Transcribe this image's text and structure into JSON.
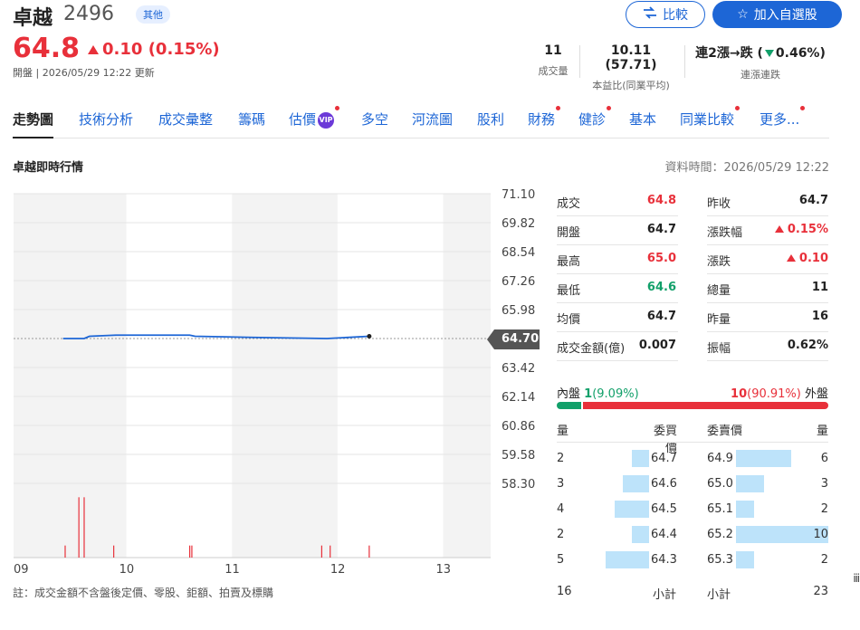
{
  "header": {
    "name": "卓越",
    "code": "2496",
    "badge": "其他",
    "compare_label": "比較",
    "watch_label": "加入自選股",
    "price": "64.8",
    "change": "0.10",
    "change_pct": "(0.15%)",
    "sub_info": "開盤 | 2026/05/29 12:22 更新"
  },
  "stats": {
    "volume_value": "11",
    "volume_label": "成交量",
    "pe_value": "10.11 (57.71)",
    "pe_label": "本益比(同業平均)",
    "streak_prefix": "連2漲→跌 (",
    "streak_pct": "0.46%)",
    "streak_label": "連漲連跌"
  },
  "tabs": [
    {
      "label": "走勢圖",
      "active": true
    },
    {
      "label": "技術分析"
    },
    {
      "label": "成交彙整"
    },
    {
      "label": "籌碼"
    },
    {
      "label": "估價",
      "vip": "VIP",
      "dot": true
    },
    {
      "label": "多空"
    },
    {
      "label": "河流圖"
    },
    {
      "label": "股利"
    },
    {
      "label": "財務",
      "dot": true
    },
    {
      "label": "健診",
      "dot": true
    },
    {
      "label": "基本"
    },
    {
      "label": "同業比較",
      "dot": true
    },
    {
      "label": "更多...",
      "dot": true
    }
  ],
  "section": {
    "title": "卓越即時行情",
    "data_time": "資料時間：2026/05/29 12:22"
  },
  "chart_data": {
    "type": "line",
    "y_ticks": [
      "71.10",
      "69.82",
      "68.54",
      "67.26",
      "65.98",
      "64.70",
      "63.42",
      "62.14",
      "60.86",
      "59.58",
      "58.30"
    ],
    "x_ticks": [
      "09",
      "10",
      "11",
      "12",
      "13"
    ],
    "reference_price": 64.7,
    "ylim": [
      58.3,
      71.1
    ],
    "series": [
      {
        "x": [
          9.4,
          9.6,
          9.65,
          9.9,
          10.2,
          10.6,
          10.65,
          11.2,
          11.9,
          12.3
        ],
        "y": [
          64.7,
          64.7,
          64.8,
          64.85,
          64.85,
          64.85,
          64.8,
          64.75,
          64.7,
          64.8
        ]
      }
    ],
    "volume": {
      "x": [
        9.42,
        9.55,
        9.6,
        9.88,
        10.6,
        10.62,
        11.85,
        11.93,
        12.3
      ],
      "v": [
        1,
        5,
        5,
        1,
        1,
        1,
        1,
        1,
        1
      ]
    },
    "current_label": "64.70"
  },
  "quote": {
    "rows": [
      {
        "l1": "成交",
        "v1": "64.8",
        "c1": "red",
        "l2": "昨收",
        "v2": "64.7",
        "c2": ""
      },
      {
        "l1": "開盤",
        "v1": "64.7",
        "c1": "",
        "l2": "漲跌幅",
        "v2": "0.15%",
        "c2": "red"
      },
      {
        "l1": "最高",
        "v1": "65.0",
        "c1": "red",
        "l2": "漲跌",
        "v2": "0.10",
        "c2": "red"
      },
      {
        "l1": "最低",
        "v1": "64.6",
        "c1": "green",
        "l2": "總量",
        "v2": "11",
        "c2": ""
      },
      {
        "l1": "均價",
        "v1": "64.7",
        "c1": "",
        "l2": "昨量",
        "v2": "16",
        "c2": ""
      },
      {
        "l1": "成交金額(億)",
        "v1": "0.007",
        "c1": "",
        "l2": "振幅",
        "v2": "0.62%",
        "c2": ""
      }
    ]
  },
  "inout": {
    "inner_label": "內盤",
    "inner_value": "1",
    "inner_pct": "(9.09%)",
    "outer_value": "10",
    "outer_pct": "(90.91%)",
    "outer_label": "外盤",
    "inner_fraction": 0.0909
  },
  "orderbook": {
    "headers": {
      "qty": "量",
      "bid": "委買價",
      "ask": "委賣價",
      "qty2": "量"
    },
    "bids": [
      {
        "qty": "2",
        "price": "64.7",
        "n": 2
      },
      {
        "qty": "3",
        "price": "64.6",
        "n": 3
      },
      {
        "qty": "4",
        "price": "64.5",
        "n": 4
      },
      {
        "qty": "2",
        "price": "64.4",
        "n": 2
      },
      {
        "qty": "5",
        "price": "64.3",
        "n": 5
      }
    ],
    "asks": [
      {
        "price": "64.9",
        "qty": "6",
        "n": 6
      },
      {
        "price": "65.0",
        "qty": "3",
        "n": 3
      },
      {
        "price": "65.1",
        "qty": "2",
        "n": 2
      },
      {
        "price": "65.2",
        "qty": "10",
        "n": 10
      },
      {
        "price": "65.3",
        "qty": "2",
        "n": 2
      }
    ],
    "bid_total": "16",
    "bid_total_label": "小計",
    "ask_total_label": "小計",
    "ask_total": "23"
  },
  "footer": {
    "note": "註：成交金額不含盤後定價、零股、鉅額、拍賣及標購"
  },
  "colors": {
    "up": "#e8303a",
    "down": "#12a06a",
    "accent": "#1d66d6",
    "line": "#1d66d6"
  }
}
